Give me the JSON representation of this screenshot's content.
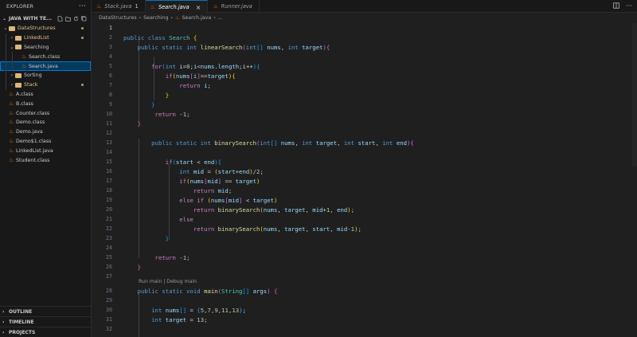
{
  "sidebar": {
    "title": "EXPLORER",
    "more": "···",
    "workspace": "JAVA WITH TE...",
    "items": [
      {
        "label": "DataStructures",
        "kind": "folder",
        "open": true,
        "depth": 0,
        "modified": true
      },
      {
        "label": "LinkedList",
        "kind": "folder",
        "open": false,
        "depth": 1,
        "modified": true
      },
      {
        "label": "Searching",
        "kind": "folder",
        "open": true,
        "depth": 1,
        "modified": false
      },
      {
        "label": "Search.class",
        "kind": "file",
        "depth": 2
      },
      {
        "label": "Search.java",
        "kind": "java",
        "depth": 2,
        "selected": true
      },
      {
        "label": "Sorting",
        "kind": "folder",
        "open": false,
        "depth": 1
      },
      {
        "label": "Stack",
        "kind": "folder",
        "open": false,
        "depth": 1,
        "modified": true
      },
      {
        "label": "A.class",
        "kind": "file",
        "depth": 0
      },
      {
        "label": "B.class",
        "kind": "file",
        "depth": 0
      },
      {
        "label": "Counter.class",
        "kind": "file",
        "depth": 0
      },
      {
        "label": "Demo.class",
        "kind": "file",
        "depth": 0
      },
      {
        "label": "Demo.java",
        "kind": "java",
        "depth": 0
      },
      {
        "label": "Demo$1.class",
        "kind": "file",
        "depth": 0
      },
      {
        "label": "LinkedList.java",
        "kind": "java",
        "depth": 0
      },
      {
        "label": "Student.class",
        "kind": "file",
        "depth": 0
      }
    ],
    "sections": [
      "OUTLINE",
      "TIMELINE",
      "PROJECTS"
    ]
  },
  "tabs": [
    {
      "label": "Stack.java",
      "badge": "1",
      "active": false
    },
    {
      "label": "Search.java",
      "active": true
    },
    {
      "label": "Runner.java",
      "active": false
    }
  ],
  "breadcrumb": [
    "DataStructures",
    "Searching",
    "Search.java",
    "..."
  ],
  "editor": {
    "codelens": "Run main | Debug main",
    "current_line": 1
  },
  "colors": {
    "accent": "#0078d4",
    "folder": "#dcb67a",
    "java": "#e76f00",
    "modified": "#e2c08d"
  }
}
